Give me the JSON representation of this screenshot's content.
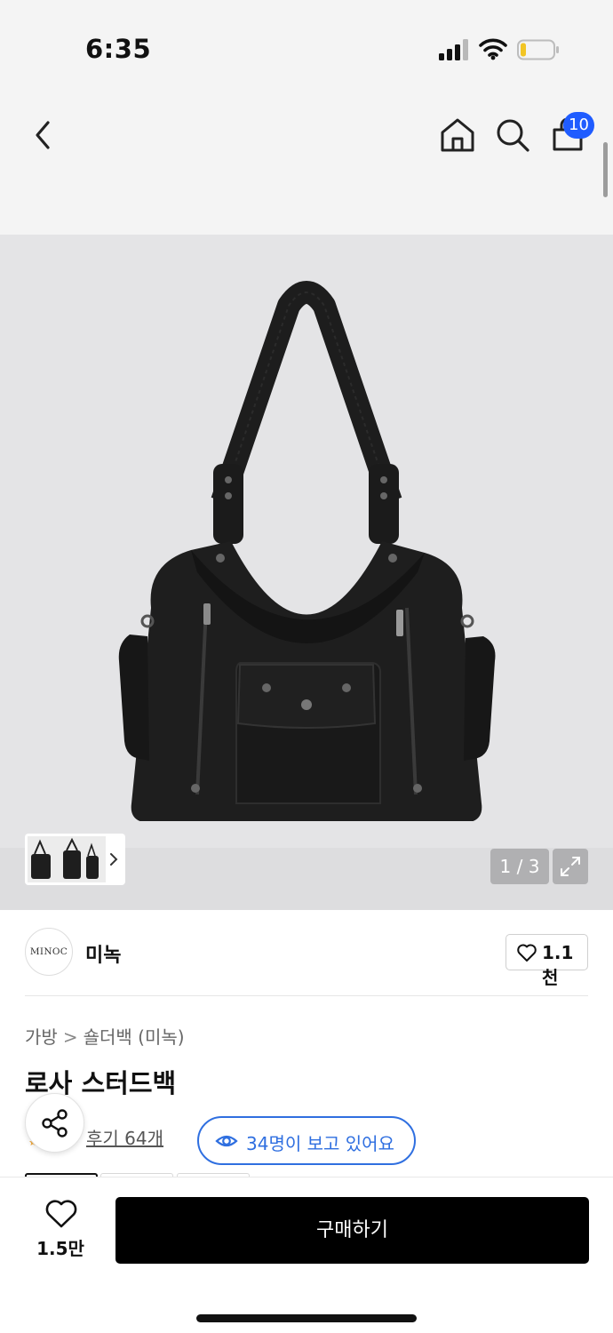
{
  "status_bar": {
    "time": "6:35",
    "icons": [
      "signal-icon",
      "wifi-icon",
      "battery-icon"
    ]
  },
  "nav": {
    "icons": [
      "back-icon",
      "home-icon",
      "search-icon",
      "cart-icon"
    ],
    "cart_badge": "10",
    "badge_color": "#1f5cff"
  },
  "gallery": {
    "page_indicator": "1 / 3",
    "icons": [
      "chevron-right-icon",
      "expand-icon"
    ]
  },
  "brand": {
    "logo_text": "MINOC",
    "name": "미녹",
    "like_count": "1.1천"
  },
  "product": {
    "breadcrumb": [
      "가방",
      "숄더백 (미녹)"
    ],
    "title": "로사 스터드백",
    "review_link": "후기 64개",
    "viewers": "34명이 보고 있어요",
    "accent_color": "#2f6fe0"
  },
  "bottom_bar": {
    "wish_count": "1.5만",
    "buy_label": "구매하기",
    "icons": [
      "heart-icon"
    ]
  }
}
